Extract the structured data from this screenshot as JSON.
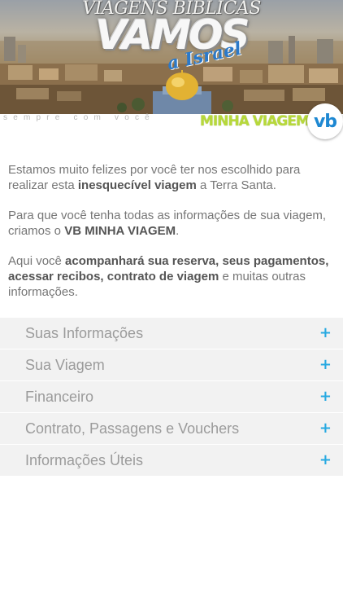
{
  "banner": {
    "title_top": "VIAGENS BIBLICAS",
    "title_main": "VAMOS",
    "title_script": "a Israel",
    "tagline": "sempre com você",
    "brand": "MINHA VIAGEM",
    "logo_text": "vb"
  },
  "intro": {
    "p1_a": "Estamos muito felizes por você ter nos escolhido para realizar esta ",
    "p1_b": "inesquecível viagem",
    "p1_c": " a Terra Santa.",
    "p2_a": "Para que você tenha todas as informações de sua viagem, criamos o ",
    "p2_b": "VB MINHA VIAGEM",
    "p2_c": ".",
    "p3_a": "Aqui você ",
    "p3_b": "acompanhará sua reserva, seus pagamentos, acessar recibos, contrato de viagem",
    "p3_c": " e muitas outras informações."
  },
  "menu": {
    "items": [
      {
        "label": "Suas Informações",
        "icon": "plus-icon",
        "symbol": "+"
      },
      {
        "label": "Sua Viagem",
        "icon": "plus-icon",
        "symbol": "+"
      },
      {
        "label": "Financeiro",
        "icon": "plus-icon",
        "symbol": "+"
      },
      {
        "label": "Contrato, Passagens e Vouchers",
        "icon": "plus-icon",
        "symbol": "+"
      },
      {
        "label": "Informações Úteis",
        "icon": "plus-icon",
        "symbol": "+"
      }
    ]
  },
  "colors": {
    "accent_blue": "#27a9e1",
    "brand_green": "#b7d93a",
    "menu_bg": "#f2f2f2"
  }
}
